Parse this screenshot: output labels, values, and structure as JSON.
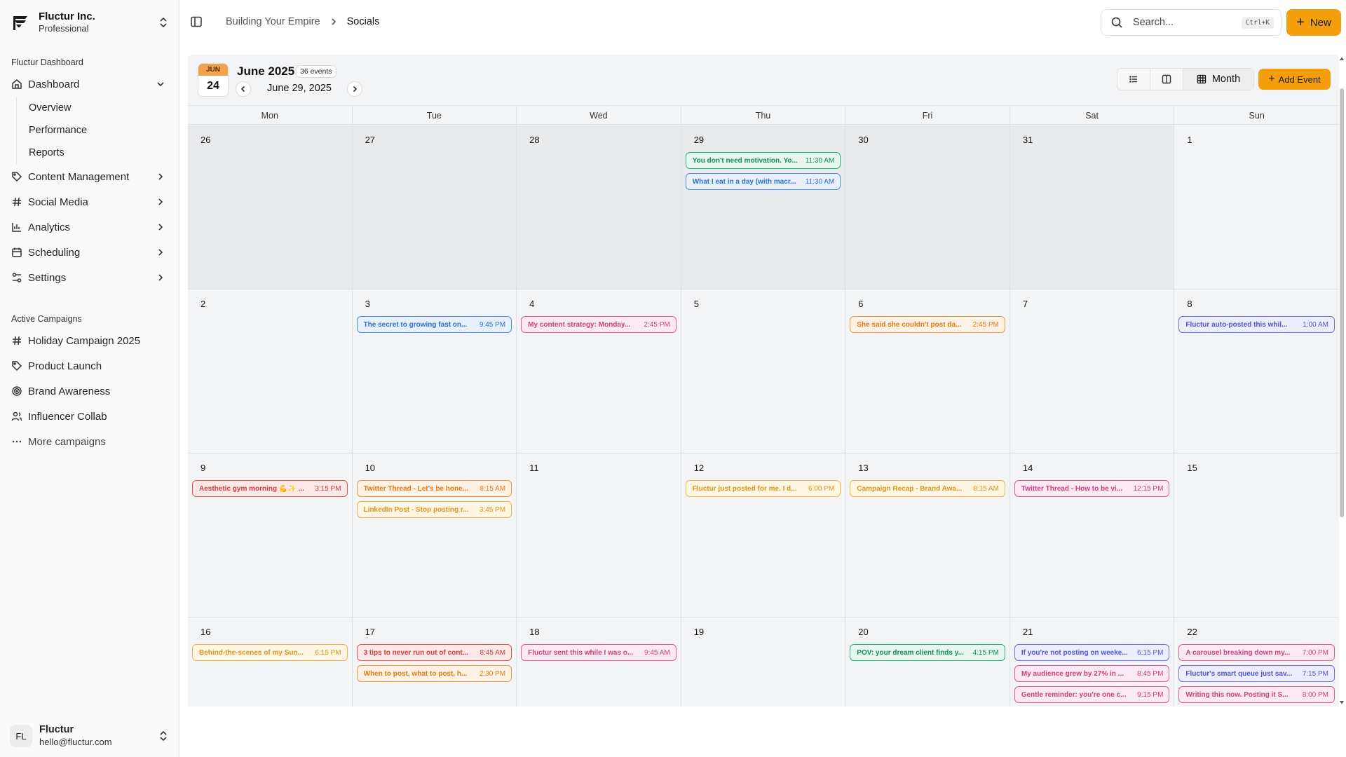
{
  "org": {
    "name": "Fluctur Inc.",
    "plan": "Professional"
  },
  "sidebar": {
    "section_label": "Fluctur Dashboard",
    "dashboard": {
      "label": "Dashboard",
      "icon": "home-icon"
    },
    "subitems": [
      {
        "label": "Overview"
      },
      {
        "label": "Performance"
      },
      {
        "label": "Reports"
      }
    ],
    "items": [
      {
        "label": "Content Management",
        "icon": "tag-icon"
      },
      {
        "label": "Social Media",
        "icon": "hash-icon"
      },
      {
        "label": "Analytics",
        "icon": "bar-chart-icon"
      },
      {
        "label": "Scheduling",
        "icon": "calendar-icon"
      },
      {
        "label": "Settings",
        "icon": "sliders-icon"
      }
    ],
    "campaigns_label": "Active Campaigns",
    "campaigns": [
      {
        "label": "Holiday Campaign 2025",
        "icon": "hash-icon"
      },
      {
        "label": "Product Launch",
        "icon": "tag-icon"
      },
      {
        "label": "Brand Awareness",
        "icon": "target-icon"
      },
      {
        "label": "Influencer Collab",
        "icon": "users-icon"
      },
      {
        "label": "More campaigns",
        "icon": "more-dots-icon"
      }
    ]
  },
  "user": {
    "initials": "FL",
    "name": "Fluctur",
    "email": "hello@fluctur.com"
  },
  "header": {
    "breadcrumb": [
      "Building Your Empire",
      "Socials"
    ],
    "search_placeholder": "Search...",
    "search_shortcut": "Ctrl+K",
    "new_label": "New"
  },
  "calendar": {
    "badge_month": "JUN",
    "badge_day": "24",
    "title": "June 2025",
    "event_count": "36 events",
    "range_label": "June 29, 2025",
    "view_label": "Month",
    "add_event_label": "Add Event",
    "weekdays": [
      "Mon",
      "Tue",
      "Wed",
      "Thu",
      "Fri",
      "Sat",
      "Sun"
    ],
    "days": [
      {
        "num": "26",
        "outside": true,
        "events": []
      },
      {
        "num": "27",
        "outside": true,
        "events": []
      },
      {
        "num": "28",
        "outside": true,
        "events": []
      },
      {
        "num": "29",
        "outside": true,
        "events": [
          {
            "title": "You don't need motivation. Yo...",
            "time": "11:30 AM",
            "color": "green"
          },
          {
            "title": "What I eat in a day (with macr...",
            "time": "11:30 AM",
            "color": "blue"
          }
        ]
      },
      {
        "num": "30",
        "outside": true,
        "events": []
      },
      {
        "num": "31",
        "outside": true,
        "events": []
      },
      {
        "num": "1",
        "outside": false,
        "events": []
      },
      {
        "num": "2",
        "outside": false,
        "events": []
      },
      {
        "num": "3",
        "outside": false,
        "events": [
          {
            "title": "The secret to growing fast on...",
            "time": "9:45 PM",
            "color": "blue"
          }
        ]
      },
      {
        "num": "4",
        "outside": false,
        "events": [
          {
            "title": "My content strategy: Monday...",
            "time": "2:45 PM",
            "color": "pink"
          }
        ]
      },
      {
        "num": "5",
        "outside": false,
        "events": []
      },
      {
        "num": "6",
        "outside": false,
        "events": [
          {
            "title": "She said she couldn't post da...",
            "time": "2:45 PM",
            "color": "orange"
          }
        ]
      },
      {
        "num": "7",
        "outside": false,
        "events": []
      },
      {
        "num": "8",
        "outside": false,
        "events": [
          {
            "title": "Fluctur auto-posted this whil...",
            "time": "1:00 AM",
            "color": "indigo"
          }
        ]
      },
      {
        "num": "9",
        "outside": false,
        "events": [
          {
            "title": "Aesthetic gym morning 💪✨ ...",
            "time": "3:15 PM",
            "color": "red"
          }
        ]
      },
      {
        "num": "10",
        "outside": false,
        "events": [
          {
            "title": "Twitter Thread - Let's be hone...",
            "time": "8:15 AM",
            "color": "orange"
          },
          {
            "title": "LinkedIn Post - Stop posting r...",
            "time": "3:45 PM",
            "color": "amber"
          }
        ]
      },
      {
        "num": "11",
        "outside": false,
        "events": []
      },
      {
        "num": "12",
        "outside": false,
        "events": [
          {
            "title": "Fluctur just posted for me. I d...",
            "time": "6:00 PM",
            "color": "amber"
          }
        ]
      },
      {
        "num": "13",
        "outside": false,
        "events": [
          {
            "title": "Campaign Recap - Brand Awa...",
            "time": "8:15 AM",
            "color": "amber"
          }
        ]
      },
      {
        "num": "14",
        "outside": false,
        "events": [
          {
            "title": "Twitter Thread - How to be vi...",
            "time": "12:15 PM",
            "color": "pink"
          }
        ]
      },
      {
        "num": "15",
        "outside": false,
        "events": []
      },
      {
        "num": "16",
        "outside": false,
        "events": [
          {
            "title": "Behind-the-scenes of my Sun...",
            "time": "6:15 PM",
            "color": "amber"
          }
        ]
      },
      {
        "num": "17",
        "outside": false,
        "events": [
          {
            "title": "3 tips to never run out of cont...",
            "time": "8:45 AM",
            "color": "red"
          },
          {
            "title": "When to post, what to post, h...",
            "time": "2:30 PM",
            "color": "orange"
          }
        ]
      },
      {
        "num": "18",
        "outside": false,
        "events": [
          {
            "title": "Fluctur sent this while I was o...",
            "time": "9:45 AM",
            "color": "pink"
          }
        ]
      },
      {
        "num": "19",
        "outside": false,
        "events": []
      },
      {
        "num": "20",
        "outside": false,
        "events": [
          {
            "title": "POV: your dream client finds y...",
            "time": "4:15 PM",
            "color": "green"
          }
        ]
      },
      {
        "num": "21",
        "outside": false,
        "events": [
          {
            "title": "If you're not posting on weeke...",
            "time": "6:15 PM",
            "color": "indigo"
          },
          {
            "title": "My audience grew by 27% in ...",
            "time": "8:45 PM",
            "color": "pink"
          },
          {
            "title": "Gentle reminder: you're one c...",
            "time": "9:15 PM",
            "color": "pink"
          }
        ]
      },
      {
        "num": "22",
        "outside": false,
        "events": [
          {
            "title": "A carousel breaking down my...",
            "time": "7:00 PM",
            "color": "pink"
          },
          {
            "title": "Fluctur's smart queue just sav...",
            "time": "7:15 PM",
            "color": "indigo"
          },
          {
            "title": "Writing this now. Posting it S...",
            "time": "8:00 PM",
            "color": "pink"
          }
        ]
      }
    ]
  },
  "colors": {
    "accent": "#f59e0b",
    "calendar_bg": "#f3f4f6",
    "outside_day_bg": "#e9eaec"
  }
}
